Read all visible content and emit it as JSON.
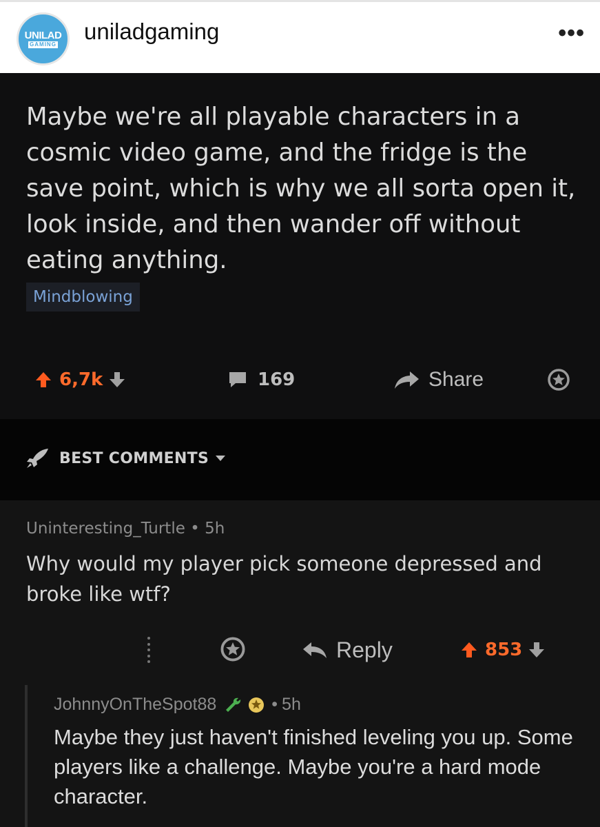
{
  "instagram": {
    "avatar_line1": "UNILAD",
    "avatar_line2": "GAMING",
    "username": "uniladgaming",
    "more_label": "•••"
  },
  "post": {
    "title": "Maybe we're all playable characters in a cosmic video game, and the fridge is the save point, which is why we all sorta open it, look inside, and then wander off without eating anything.",
    "flair": "Mindblowing",
    "votes": "6,7k",
    "comments": "169",
    "share_label": "Share"
  },
  "sort": {
    "label": "BEST COMMENTS"
  },
  "comments": [
    {
      "author": "Uninteresting_Turtle",
      "separator": "•",
      "age": "5h",
      "body": "Why would my player pick someone depressed and broke like wtf?",
      "reply_label": "Reply",
      "votes": "853"
    },
    {
      "author": "JohnnyOnTheSpot88",
      "separator": "•",
      "age": "5h",
      "body": "Maybe they just haven't finished leveling you up. Some players like a challenge. Maybe you're a hard mode character."
    }
  ],
  "colors": {
    "upvote": "#ff6a2b",
    "flair_text": "#7aa2d6",
    "avatar_bg": "#4aa8dc"
  },
  "icons": [
    "more-icon",
    "upvote-icon",
    "downvote-icon",
    "comment-icon",
    "share-icon",
    "award-icon",
    "rocket-icon",
    "reply-icon",
    "overflow-icon",
    "wrench-icon",
    "gold-award-icon"
  ]
}
